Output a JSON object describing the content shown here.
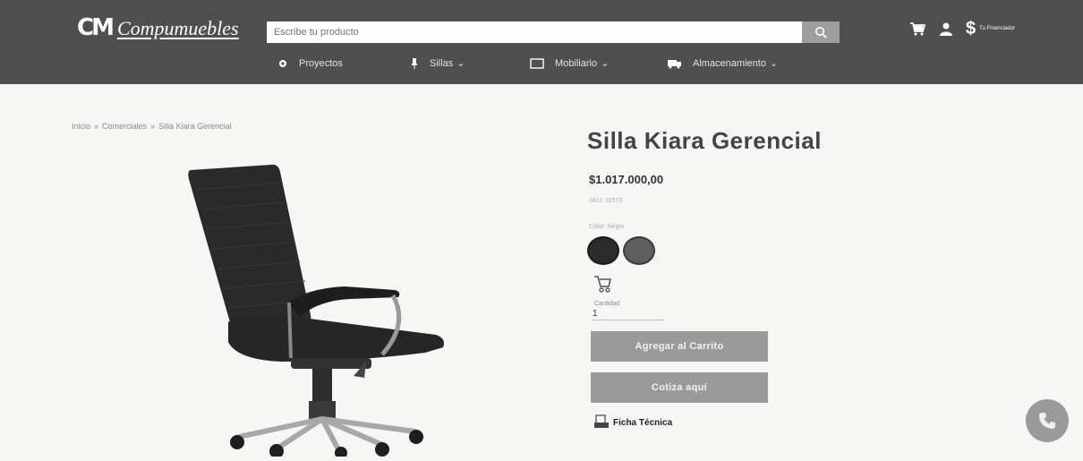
{
  "header": {
    "logo_mark": "CM",
    "logo_text": "Compumuebles",
    "search_placeholder": "Escribe tu producto",
    "search_icon": "search-icon",
    "cart_icon": "cart-icon",
    "user_icon": "user-icon",
    "currency_symbol": "$",
    "financing_label": "Tu Financiador"
  },
  "nav": {
    "items": [
      {
        "label": "Proyectos",
        "icon": "gear-icon"
      },
      {
        "label": "Sillas",
        "icon": "chair-icon"
      },
      {
        "label": "Mobiliario",
        "icon": "desk-icon"
      },
      {
        "label": "Almacenamiento",
        "icon": "truck-icon"
      }
    ],
    "dropdown_marker": "⌄"
  },
  "breadcrumb": {
    "items": [
      "Inicio",
      "Comerciales",
      "Silla Kiara Gerencial"
    ],
    "separator": "»"
  },
  "product": {
    "title": "Silla Kiara Gerencial",
    "price": "$1.017.000,00",
    "sku": "SKU: 11573",
    "color_label": "Color: Negro",
    "colors": [
      "#2b2b2b",
      "#5e5e5e"
    ],
    "quantity_label": "Cantidad",
    "quantity_value": "1",
    "add_to_cart_label": "Agregar al Carrito",
    "quote_label": "Cotiza aquí",
    "datasheet_label": "Ficha Técnica"
  },
  "theme": {
    "header_bg": "#4f4f4f",
    "button_bg": "#9a9a9a"
  }
}
